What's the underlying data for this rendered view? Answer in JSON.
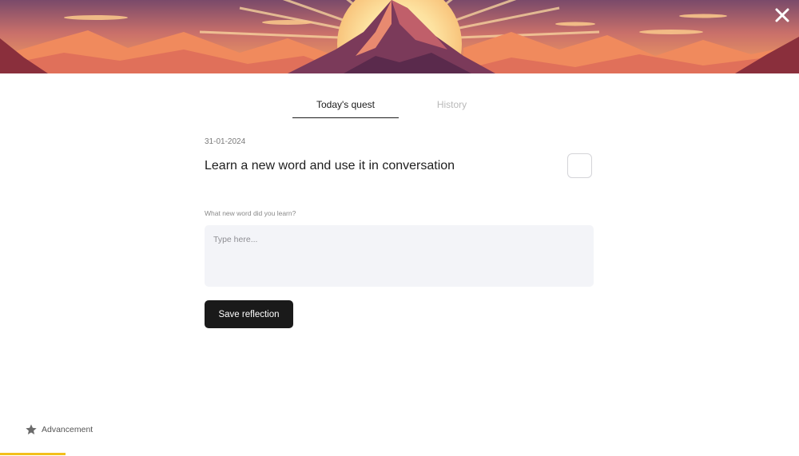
{
  "banner": {
    "close_icon": "close-icon",
    "colors": {
      "sky_top": "#7a4a6a",
      "sky_mid": "#f2a060",
      "sun": "#fde7a6",
      "mountain_far": "#f28c5c",
      "mountain_main": "#7b3a5a"
    }
  },
  "tabs": [
    {
      "label": "Today's quest",
      "active": true
    },
    {
      "label": "History",
      "active": false
    }
  ],
  "quest": {
    "date": "31-01-2024",
    "title": "Learn a new word and use it in conversation",
    "completed": false
  },
  "reflection": {
    "prompt": "What new word did you learn?",
    "placeholder": "Type here...",
    "value": "",
    "save_label": "Save reflection"
  },
  "footer": {
    "advancement_icon": "star-icon",
    "advancement_label": "Advancement",
    "progress": 0.082,
    "progress_color": "#f2c01c"
  }
}
